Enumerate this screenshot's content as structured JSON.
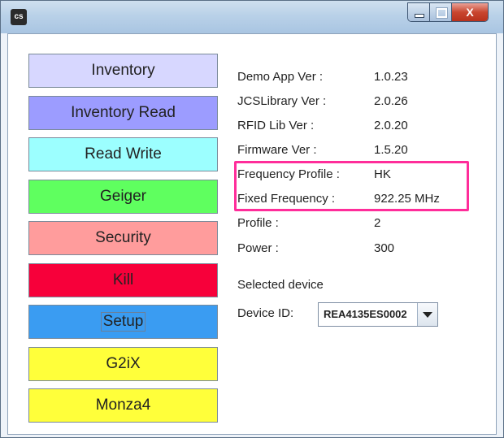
{
  "window": {
    "icon_text": "cs",
    "close_glyph": "X"
  },
  "menu": {
    "items": [
      {
        "label": "Inventory",
        "color": "#d7d7ff"
      },
      {
        "label": "Inventory Read",
        "color": "#9c9cff"
      },
      {
        "label": "Read Write",
        "color": "#9cffff"
      },
      {
        "label": "Geiger",
        "color": "#5fff5f"
      },
      {
        "label": "Security",
        "color": "#ff9c9c"
      },
      {
        "label": "Kill",
        "color": "#f7003a"
      },
      {
        "label": "Setup",
        "color": "#3a9cf2"
      },
      {
        "label": "G2iX",
        "color": "#ffff3a"
      },
      {
        "label": "Monza4",
        "color": "#ffff3a"
      }
    ]
  },
  "info": {
    "demo_app_ver_label": "Demo App Ver :",
    "demo_app_ver_value": "1.0.23",
    "jcs_library_ver_label": "JCSLibrary Ver :",
    "jcs_library_ver_value": "2.0.26",
    "rfid_lib_ver_label": "RFID Lib Ver :",
    "rfid_lib_ver_value": "2.0.20",
    "firmware_ver_label": "Firmware Ver :",
    "firmware_ver_value": "1.5.20",
    "frequency_profile_label": "Frequency Profile :",
    "frequency_profile_value": "HK",
    "fixed_frequency_label": "Fixed Frequency :",
    "fixed_frequency_value": "922.25 MHz",
    "profile_label": "Profile :",
    "profile_value": "2",
    "power_label": "Power :",
    "power_value": "300"
  },
  "device": {
    "selected_label": "Selected device",
    "device_id_label": "Device ID:",
    "device_id_value": "REA4135ES0002"
  },
  "colors": {
    "highlight": "#ff2d9a"
  }
}
